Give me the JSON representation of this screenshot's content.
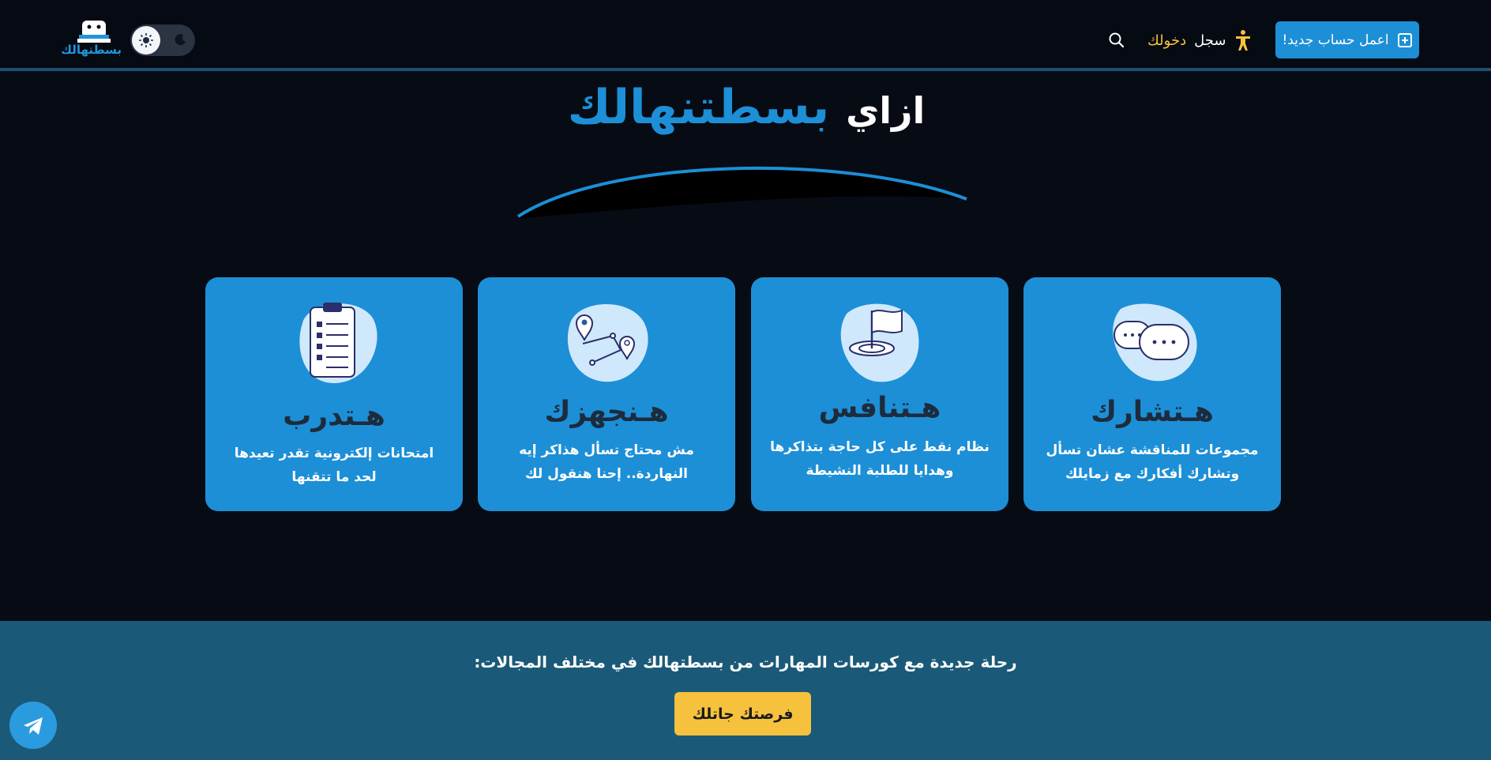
{
  "header": {
    "signup_label": "اعمل حساب جديد!",
    "login_prefix": "سجل",
    "login_accent": "دخولك",
    "logo_text": "بسطتهالك"
  },
  "heading": {
    "white_part": "ازاي",
    "blue_part": "بسطتنهالك"
  },
  "cards": [
    {
      "title": "هـتشارك",
      "desc": "مجموعات للمناقشة عشان تسأل وتشارك أفكارك مع زمايلك",
      "icon": "chat-bubbles-icon"
    },
    {
      "title": "هـتنافس",
      "desc": "نظام نقط على كل حاجة بتذاكرها وهدايا للطلبة النشيطة",
      "icon": "flag-target-icon"
    },
    {
      "title": "هـنجهزك",
      "desc": "مش محتاج تسأل هذاكر إيه النهاردة.. إحنا هنقول لك",
      "icon": "route-map-icon"
    },
    {
      "title": "هـتدرب",
      "desc": "امتحانات إلكترونية تقدر تعيدها لحد ما تتقنها",
      "icon": "clipboard-icon"
    }
  ],
  "band": {
    "text": "رحلة جديدة مع كورسات المهارات من بسطتهالك في مختلف المجالات:",
    "cta_label": "فرصتك جاتلك"
  },
  "colors": {
    "primary": "#1c8fd7",
    "accent": "#f6c23e",
    "background": "#070b14",
    "band": "#1a5a78"
  }
}
